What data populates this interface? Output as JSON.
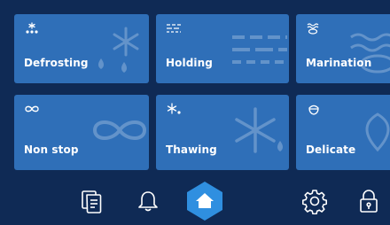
{
  "tiles": [
    {
      "label": "Defrosting",
      "icon": "defrost-icon"
    },
    {
      "label": "Holding",
      "icon": "holding-icon"
    },
    {
      "label": "Marination",
      "icon": "marination-icon"
    },
    {
      "label": "Non stop",
      "icon": "infinity-icon"
    },
    {
      "label": "Thawing",
      "icon": "thaw-icon"
    },
    {
      "label": "Delicate",
      "icon": "delicate-icon"
    }
  ],
  "nav": [
    {
      "icon": "documents-icon"
    },
    {
      "icon": "bell-icon"
    },
    {
      "icon": "home-icon",
      "active": true
    },
    {
      "icon": "gear-icon"
    },
    {
      "icon": "lock-icon"
    }
  ],
  "colors": {
    "background": "#0f2a55",
    "tile": "#2f6fb8",
    "home_active": "#2f8fe0",
    "text": "#ffffff"
  }
}
